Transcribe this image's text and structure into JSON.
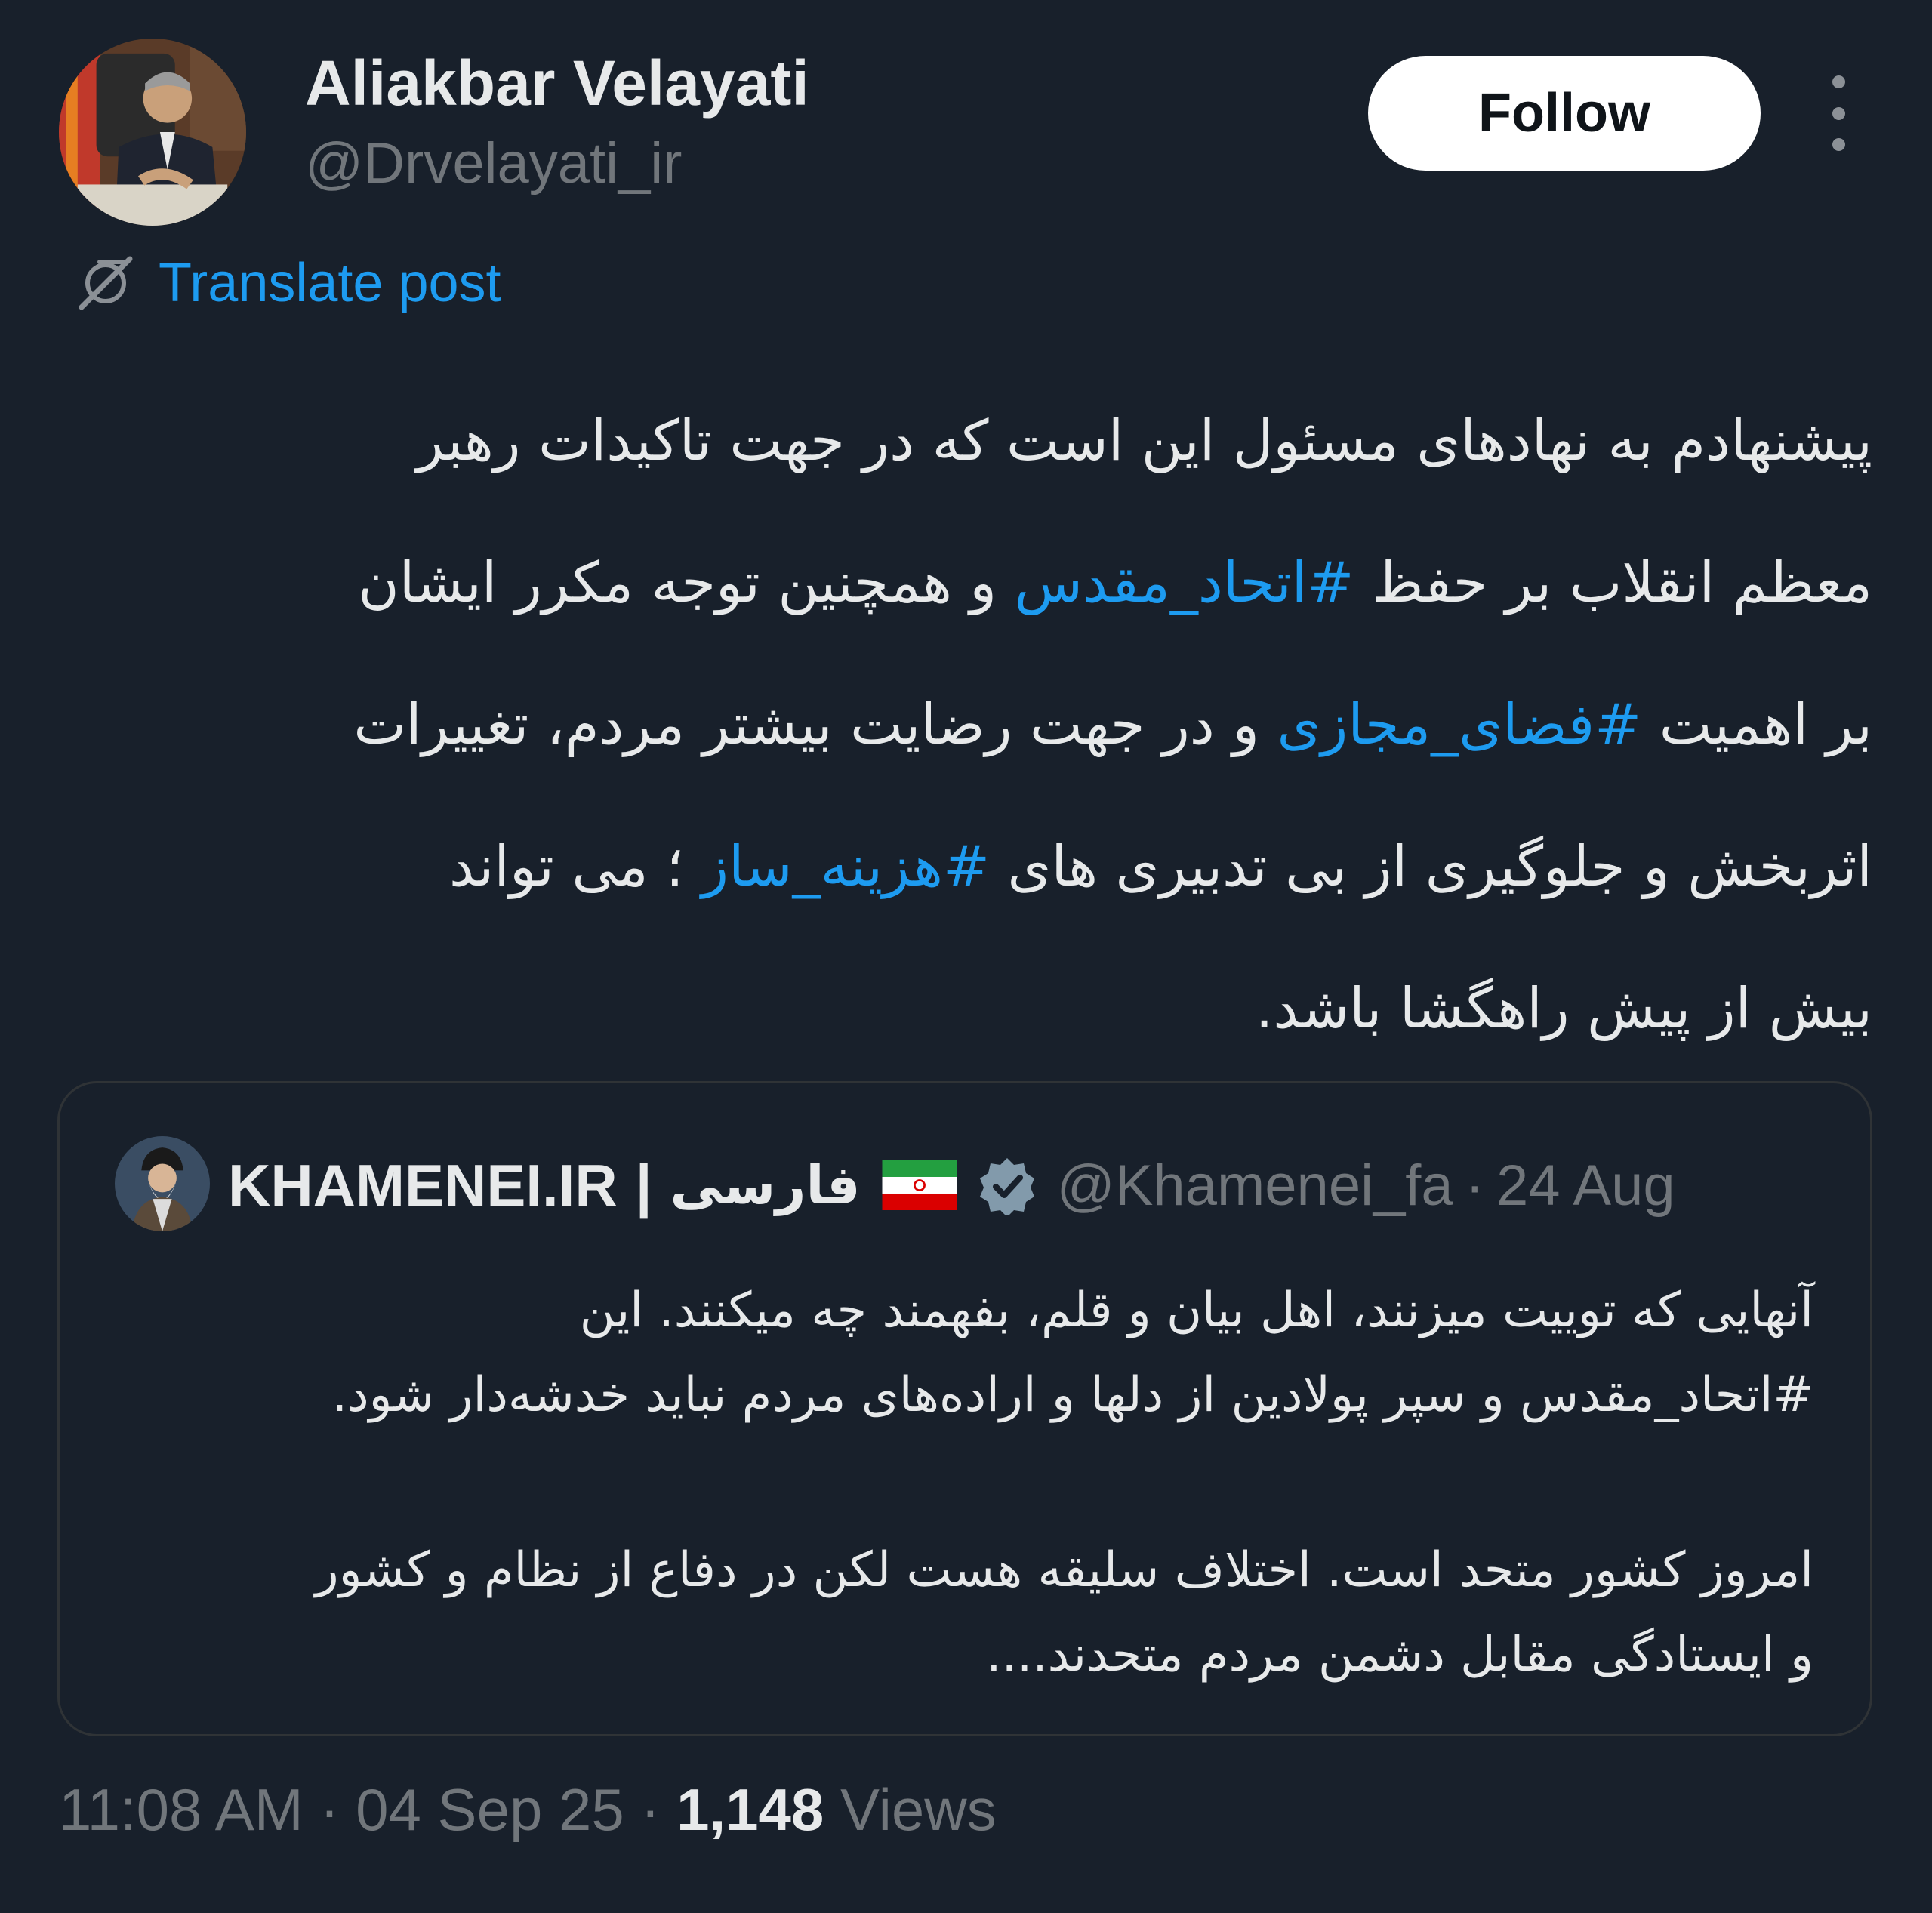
{
  "colors": {
    "background": "#18202b",
    "text": "#e7e9ea",
    "muted": "#71767b",
    "accent": "#1d9bf0",
    "follow_bg": "#ffffff"
  },
  "author": {
    "name": "Aliakbar Velayati",
    "handle": "@Drvelayati_ir"
  },
  "follow_label": "Follow",
  "more_icon": "more-vertical-icon",
  "translate": {
    "icon": "translate-icon",
    "label": "Translate post"
  },
  "post": {
    "line1": "پیشنهادم به نهادهای مسئول این است که در جهت تاکیدات رهبر",
    "line2_part1": "معظم انقلاب بر حفظ ",
    "line2_hashtag": "#اتحاد_مقدس",
    "line2_part2": " و همچنین توجه مکرر ایشان",
    "line3_part1": "بر اهمیت ",
    "line3_hashtag": "#فضای_مجازی",
    "line3_part2": " و در جهت رضایت بیشتر مردم، تغییرات",
    "line4_part1": "اثربخش و جلوگیری از بی تدبیری های ",
    "line4_hashtag": "#هزینه_ساز",
    "line4_part2": " ؛ می تواند",
    "line5": "بیش از پیش راهگشا باشد."
  },
  "quote": {
    "name": "KHAMENEI.IR",
    "separator": "|",
    "lang": "فارسی",
    "flag_icon": "iran-flag-icon",
    "verified_icon": "verified-badge-icon",
    "handle": "@Khamenei_fa",
    "dot": "·",
    "date": "24 Aug",
    "line1": "آنهایی که توییت میزنند، اهل بیان و قلم، بفهمند چه میکنند. این",
    "line2": "#اتحاد_مقدس و سپر پولادین از دلها و اراده‌های مردم نباید خدشه‌دار شود.",
    "line3": "امروز کشور متحد است. اختلاف سلیقه هست لکن در دفاع از نظام و کشور",
    "line4": "و ایستادگی مقابل دشمن مردم متحدند...."
  },
  "meta": {
    "time": "11:08 AM",
    "dot1": " · ",
    "date": "04 Sep 25",
    "dot2": " · ",
    "views_count": "1,148",
    "views_label": " Views"
  }
}
